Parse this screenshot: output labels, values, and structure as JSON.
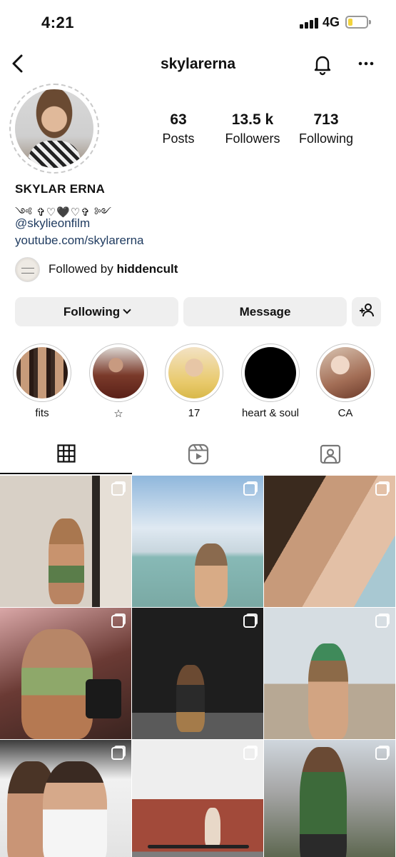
{
  "status_bar": {
    "time": "4:21",
    "network": "4G"
  },
  "header": {
    "username": "skylarerna"
  },
  "stats": [
    {
      "value": "63",
      "label": "Posts"
    },
    {
      "value": "13.5 k",
      "label": "Followers"
    },
    {
      "value": "713",
      "label": "Following"
    }
  ],
  "bio": {
    "name": "SKYLAR ERNA",
    "decoration": "༺ ✞♡🖤♡✞ ༻",
    "mention": "@skylieonfilm",
    "link": "youtube.com/skylarerna"
  },
  "followed_by": {
    "prefix": "Followed by ",
    "user": "hiddencult"
  },
  "buttons": {
    "following": "Following",
    "message": "Message"
  },
  "highlights": [
    {
      "label": "fits"
    },
    {
      "label": "☆"
    },
    {
      "label": "17"
    },
    {
      "label": "heart & soul"
    },
    {
      "label": "CA"
    }
  ],
  "tabs": [
    {
      "name": "posts-grid",
      "icon": "grid-icon",
      "active": true
    },
    {
      "name": "reels",
      "icon": "reels-icon",
      "active": false
    },
    {
      "name": "tagged",
      "icon": "tagged-icon",
      "active": false
    }
  ],
  "colors": {
    "link": "#1e3a5f",
    "button_bg": "#efefef"
  }
}
